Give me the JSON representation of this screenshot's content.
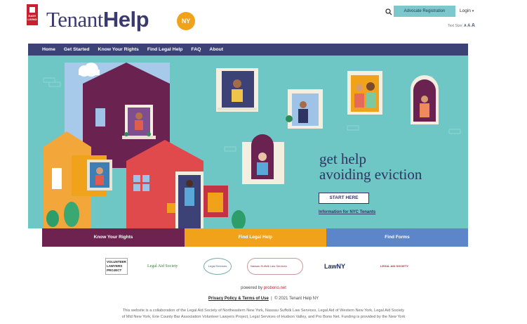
{
  "header": {
    "badge_text": "EASY LIVING",
    "logo_part1": "Tenant",
    "logo_part2": "Help",
    "ny_badge": "NY",
    "advocate_label": "Advocate Registration",
    "login_label": "Login",
    "text_size_label": "Text Size:",
    "text_size_options": [
      "A",
      "A",
      "A"
    ]
  },
  "nav": {
    "items": [
      "Home",
      "Get Started",
      "Know Your Rights",
      "Find Legal Help",
      "FAQ",
      "About"
    ]
  },
  "hero": {
    "title_line1": "get help",
    "title_line2": "avoiding eviction",
    "start_label": "START HERE",
    "nyc_link": "Information for NYC Tenants"
  },
  "cta": {
    "know_rights": "Know Your Rights",
    "find_help": "Find Legal Help",
    "find_forms": "Find Forms"
  },
  "partners": [
    "VOLUNTEER LAWYERS PROJECT",
    "Legal Aid Society",
    "Legal Services",
    "Nassau Suffolk Law Services",
    "LawNY",
    "LEGAL AID SOCIETY"
  ],
  "footer": {
    "powered_prefix": "powered by",
    "powered_brand": "probono.net",
    "privacy_link": "Privacy Policy & Terms of Use",
    "separator": "|",
    "copyright": "© 2021 Tenant Help NY",
    "collab_line1": "This website is a collaboration of the Legal Aid Society of Northeastern New York, Nassau Suffolk Law Services, Legal Aid of Western New York, Legal Aid Society",
    "collab_line2": "of Mid New York, Erie County Bar Association Volunteer Lawyers Project, Legal Services of Hudson Valley, and Pro Bono Net. Funding is provided by the New York"
  },
  "colors": {
    "nav_bg": "#3d4276",
    "hero_bg": "#6ec7c5",
    "accent_red": "#c8202f",
    "accent_orange": "#f0a21b",
    "accent_purple": "#6d2250",
    "accent_blue": "#5c86c9"
  }
}
